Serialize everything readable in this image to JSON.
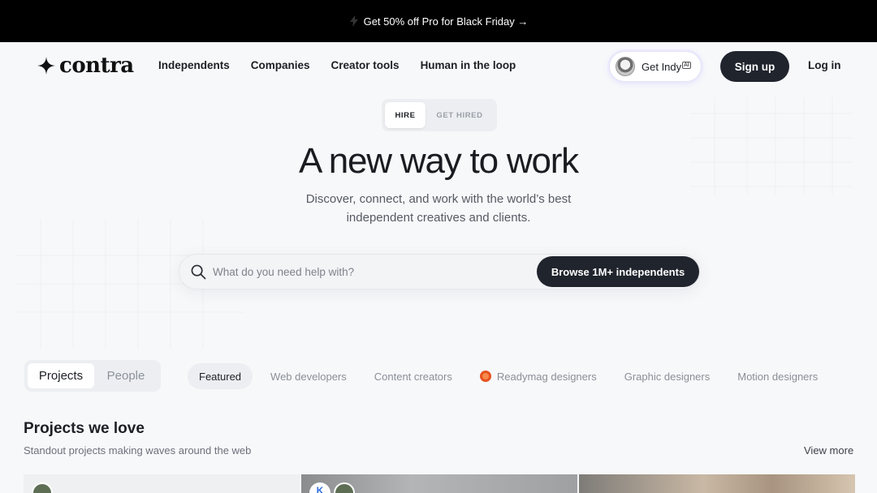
{
  "promo": {
    "text": "Get 50% off Pro for Black Friday →"
  },
  "nav": {
    "logo": "contra",
    "links": [
      "Independents",
      "Companies",
      "Creator tools",
      "Human in the loop"
    ],
    "get_indy": "Get Indy",
    "get_indy_badge": "AI",
    "signup": "Sign up",
    "login": "Log in"
  },
  "hero": {
    "toggle": [
      "HIRE",
      "GET HIRED"
    ],
    "title": "A new way to work",
    "subtitle_line1": "Discover, connect, and work with the world’s best",
    "subtitle_line2": "independent creatives and clients.",
    "search_placeholder": "What do you need help with?",
    "browse_button": "Browse 1M+ independents"
  },
  "filters": {
    "view_toggle": [
      "Projects",
      "People"
    ],
    "categories": [
      "Featured",
      "Web developers",
      "Content creators",
      "Readymag designers",
      "Graphic designers",
      "Motion designers"
    ]
  },
  "section": {
    "title": "Projects we love",
    "subtitle": "Standout projects making waves around the web",
    "view_more": "View more"
  },
  "colors": {
    "dark_button": "#20242d",
    "promo_bg": "#000000",
    "readymag_orange": "#e8511f"
  }
}
